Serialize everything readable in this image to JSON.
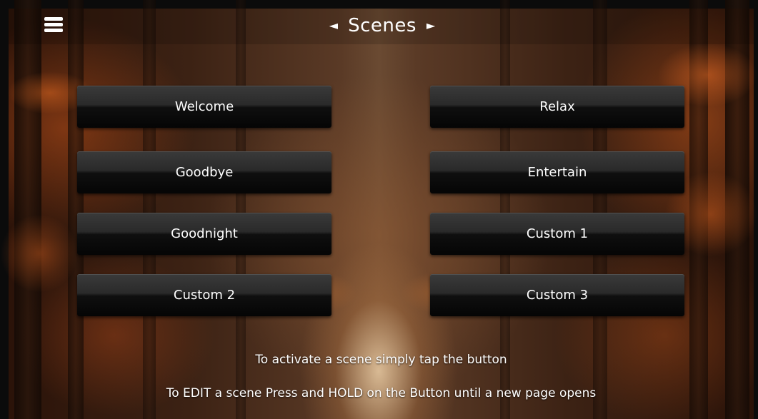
{
  "header": {
    "title": "Scenes",
    "prev_arrow": "◄",
    "next_arrow": "►",
    "menu_icon": "hamburger-menu-icon"
  },
  "scenes": {
    "left": [
      "Welcome",
      "Goodbye",
      "Goodnight",
      "Custom 2"
    ],
    "right": [
      "Relax",
      "Entertain",
      "Custom 1",
      "Custom 3"
    ]
  },
  "hints": {
    "line1": "To activate a scene simply tap the button",
    "line2": "To EDIT a scene Press and HOLD on the Button until a new page opens"
  },
  "colors": {
    "button_text": "#ffffff",
    "button_bg": "#1a1a1a",
    "frame": "#0b0b0b"
  }
}
